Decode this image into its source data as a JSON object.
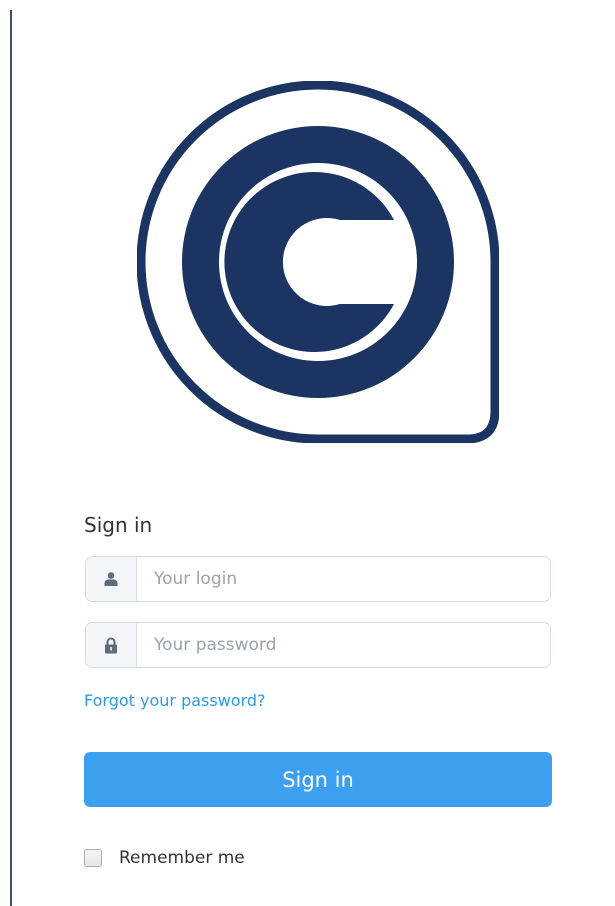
{
  "form": {
    "title": "Sign in",
    "login": {
      "placeholder": "Your login",
      "value": "",
      "icon": "user-icon"
    },
    "password": {
      "placeholder": "Your password",
      "value": "",
      "icon": "lock-icon"
    },
    "forgot_link": "Forgot your password?",
    "submit_label": "Sign in",
    "remember_label": "Remember me",
    "remember_checked": false
  },
  "logo": {
    "icon": "brand-logo-icon"
  },
  "colors": {
    "brand_navy": "#1c3461",
    "primary_button": "#3d9ff0",
    "link": "#2c9be6",
    "addon_bg": "#f3f5f8",
    "input_border": "#d8dde4"
  }
}
